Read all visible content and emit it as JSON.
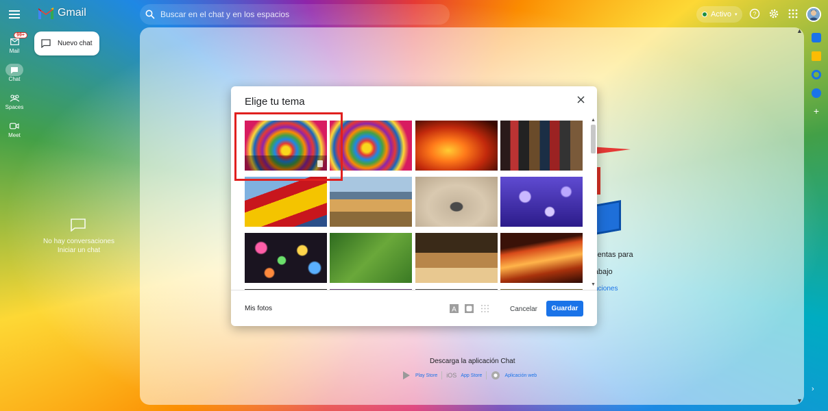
{
  "app": {
    "name": "Gmail"
  },
  "search": {
    "placeholder": "Buscar en el chat y en los espacios"
  },
  "status": {
    "label": "Activo",
    "color": "#1e8e3e"
  },
  "rail": {
    "items": [
      {
        "label": "Mail",
        "icon": "mail-icon",
        "badge": "99+"
      },
      {
        "label": "Chat",
        "icon": "chat-icon",
        "active": true
      },
      {
        "label": "Spaces",
        "icon": "spaces-icon"
      },
      {
        "label": "Meet",
        "icon": "meet-icon"
      }
    ]
  },
  "new_chat": {
    "label": "Nuevo chat"
  },
  "empty_chat": {
    "line1": "No hay conversaciones",
    "line2": "Iniciar un chat"
  },
  "background_panel": {
    "partial_text_1": "mientas para",
    "partial_text_2": "ar",
    "partial_text_3": "trabajo",
    "partial_link": "caciones",
    "download_title": "Descarga la aplicación Chat",
    "stores": [
      "Play Store",
      "iOS",
      "App Store",
      "Aplicación web"
    ]
  },
  "dialog": {
    "title": "Elige tu tema",
    "my_photos": "Mis fotos",
    "cancel": "Cancelar",
    "save": "Guardar",
    "themes": [
      {
        "name": "tie-dye-selected",
        "selected": true
      },
      {
        "name": "tie-dye"
      },
      {
        "name": "fire"
      },
      {
        "name": "movie-posters"
      },
      {
        "name": "spain-flag"
      },
      {
        "name": "golden-gate-coast"
      },
      {
        "name": "desert-rock"
      },
      {
        "name": "jellyfish"
      },
      {
        "name": "bokeh-lights"
      },
      {
        "name": "caterpillar"
      },
      {
        "name": "chess"
      },
      {
        "name": "canyon"
      }
    ]
  },
  "colors": {
    "accent": "#1a73e8",
    "highlight": "#e0201f"
  }
}
